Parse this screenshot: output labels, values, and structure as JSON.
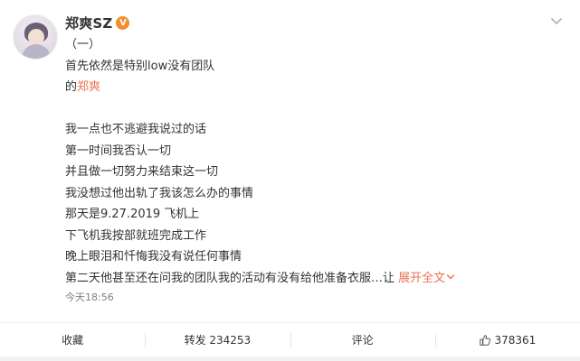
{
  "post": {
    "author": "郑爽SZ",
    "verified_badge": "V",
    "lines": [
      "（一）",
      "首先依然是特别low没有团队",
      "的",
      "",
      "我一点也不逃避我说过的话",
      "第一时间我否认一切",
      "并且做一切努力来结束这一切",
      "我没想过他出轨了我该怎么办的事情",
      "那天是9.27.2019 飞机上",
      "下飞机我按部就班完成工作",
      "晚上眼泪和忏悔我没有说任何事情",
      "第二天他甚至还在问我的团队我的活动有没有给他准备衣服…让"
    ],
    "mention_name": "郑爽",
    "expand_label": "展开全文",
    "timestamp": "今天18:56"
  },
  "actions": {
    "favorite": "收藏",
    "repost": "转发 234253",
    "comment": "评论",
    "like_count": "378361"
  },
  "colors": {
    "link": "#eb7350",
    "text": "#333333",
    "badge": "#f58d2a"
  },
  "icons": [
    "chevron-down-icon",
    "verified-icon",
    "like-icon",
    "expand-chevron-icon"
  ]
}
